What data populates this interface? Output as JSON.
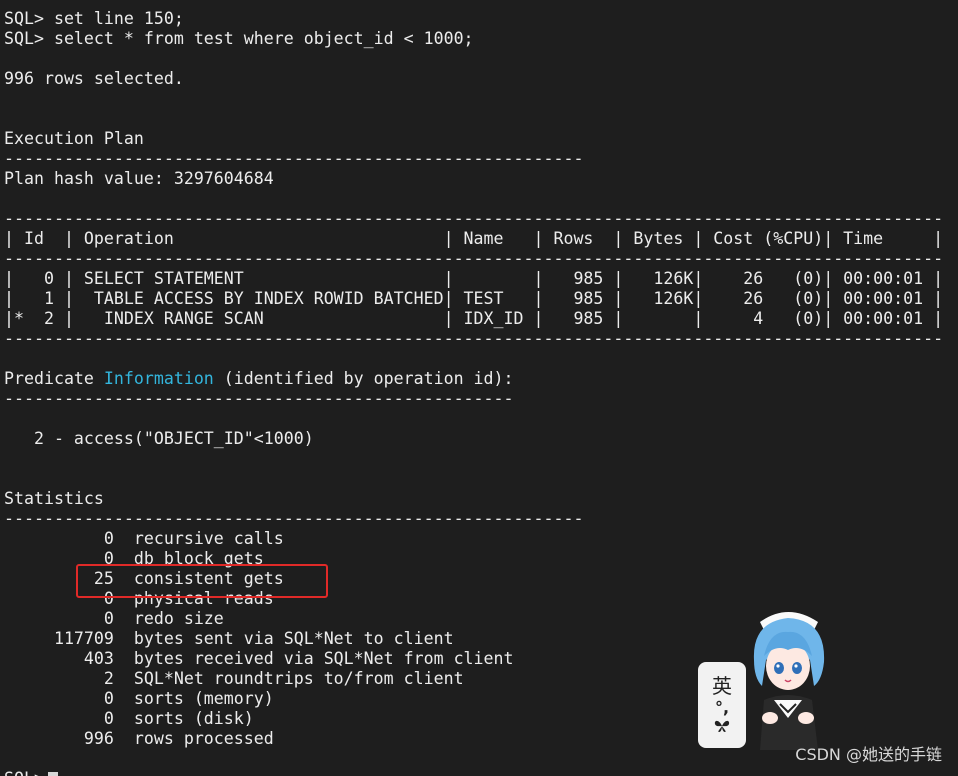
{
  "terminal": {
    "lines": [
      "SQL> set line 150;",
      "SQL> select * from test where object_id < 1000;",
      "",
      "996 rows selected.",
      "",
      "",
      "Execution Plan",
      "----------------------------------------------------------",
      "Plan hash value: 3297604684",
      "",
      "----------------------------------------------------------------------------------------------",
      "| Id  | Operation                           | Name   | Rows  | Bytes | Cost (%CPU)| Time     |",
      "----------------------------------------------------------------------------------------------",
      "|   0 | SELECT STATEMENT                    |        |   985 |   126K|    26   (0)| 00:00:01 |",
      "|   1 |  TABLE ACCESS BY INDEX ROWID BATCHED| TEST   |   985 |   126K|    26   (0)| 00:00:01 |",
      "|*  2 |   INDEX RANGE SCAN                  | IDX_ID |   985 |       |     4   (0)| 00:00:01 |",
      "----------------------------------------------------------------------------------------------",
      "",
      "Predicate Information (identified by operation id):",
      "---------------------------------------------------",
      "",
      "   2 - access(\"OBJECT_ID\"<1000)",
      "",
      "",
      "Statistics",
      "----------------------------------------------------------",
      "          0  recursive calls",
      "          0  db block gets",
      "         25  consistent gets",
      "          0  physical reads",
      "          0  redo size",
      "     117709  bytes sent via SQL*Net to client",
      "        403  bytes received via SQL*Net from client",
      "          2  SQL*Net roundtrips to/from client",
      "          0  sorts (memory)",
      "          0  sorts (disk)",
      "        996  rows processed",
      ""
    ],
    "predicate_pre": "Predicate ",
    "predicate_word": "Information",
    "predicate_post": " (identified by operation id):",
    "last_prompt": "SQL>"
  },
  "ime": {
    "lang": "英",
    "punct": "°,",
    "icon": "butterfly-icon"
  },
  "watermark": "CSDN @她送的手链",
  "colors": {
    "background": "#1e1e1e",
    "text": "#ececec",
    "highlight_word": "#33b5dc",
    "annotation_box": "#e02a28"
  }
}
